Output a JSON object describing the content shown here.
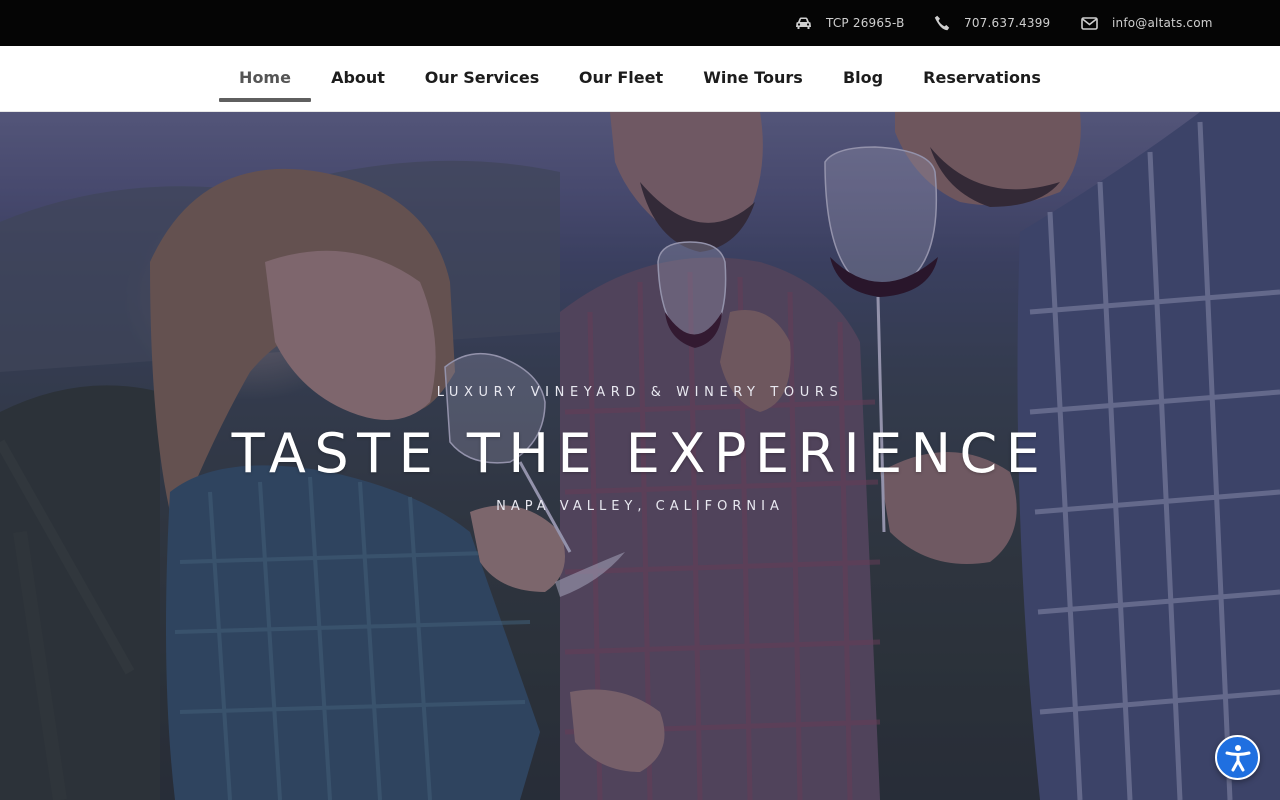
{
  "topbar": {
    "license": {
      "icon": "car-icon",
      "text": "TCP 26965-B"
    },
    "phone": {
      "icon": "phone-icon",
      "text": "707.637.4399"
    },
    "email": {
      "icon": "envelope-icon",
      "text": "info@altats.com"
    }
  },
  "nav": {
    "items": [
      {
        "label": "Home",
        "active": true
      },
      {
        "label": "About"
      },
      {
        "label": "Our Services"
      },
      {
        "label": "Our Fleet"
      },
      {
        "label": "Wine Tours"
      },
      {
        "label": "Blog"
      },
      {
        "label": "Reservations"
      }
    ]
  },
  "hero": {
    "kicker": "LUXURY VINEYARD & WINERY TOURS",
    "headline": "TASTE THE EXPERIENCE",
    "subline": "NAPA VALLEY, CALIFORNIA",
    "image": "people-tasting-wine-in-vineyard"
  },
  "accessibility": {
    "icon": "accessibility-icon",
    "color": "#1f6fe0"
  },
  "colors": {
    "topbar_bg": "#050505",
    "nav_bg": "#ffffff",
    "nav_active_underline": "#5f5f5f"
  }
}
